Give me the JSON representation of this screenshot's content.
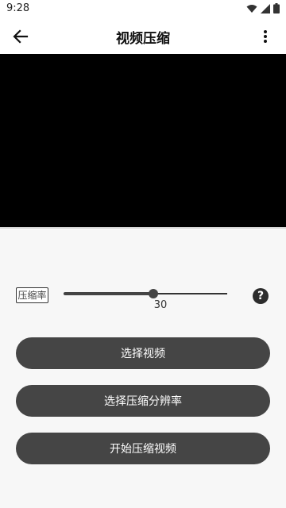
{
  "status": {
    "time": "9:28"
  },
  "appbar": {
    "title": "视频压缩",
    "back_icon": "arrow-left-icon",
    "more_icon": "more-vertical-icon"
  },
  "compress": {
    "label": "压缩率",
    "value": "30",
    "fraction": 0.55
  },
  "buttons": {
    "select_video": "选择视频",
    "select_resolution": "选择压缩分辨率",
    "start": "开始压缩视频"
  },
  "help": {
    "symbol": "?"
  },
  "colors": {
    "button_bg": "#454545",
    "video_bg": "#000000",
    "page_bg": "#f7f7f7"
  }
}
